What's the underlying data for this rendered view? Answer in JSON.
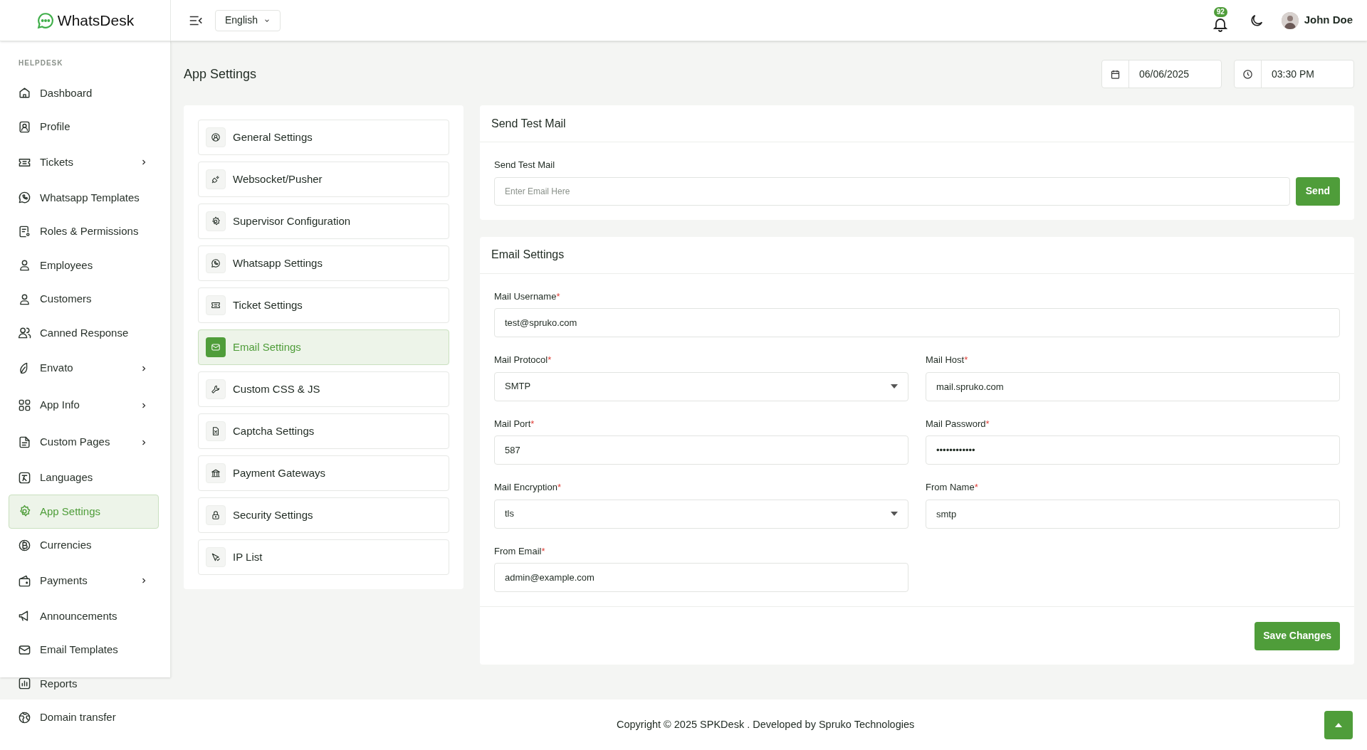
{
  "brand": {
    "name": "WhatsDesk"
  },
  "header": {
    "language": "English",
    "notifications": "92",
    "user": "John Doe"
  },
  "sidebar": {
    "section": "HELPDESK",
    "items": [
      {
        "label": "Dashboard",
        "expandable": false,
        "selected": false
      },
      {
        "label": "Profile",
        "expandable": false,
        "selected": false
      },
      {
        "label": "Tickets",
        "expandable": true,
        "selected": false
      },
      {
        "label": "Whatsapp Templates",
        "expandable": false,
        "selected": false
      },
      {
        "label": "Roles & Permissions",
        "expandable": false,
        "selected": false
      },
      {
        "label": "Employees",
        "expandable": false,
        "selected": false
      },
      {
        "label": "Customers",
        "expandable": false,
        "selected": false
      },
      {
        "label": "Canned Response",
        "expandable": false,
        "selected": false
      },
      {
        "label": "Envato",
        "expandable": true,
        "selected": false
      },
      {
        "label": "App Info",
        "expandable": true,
        "selected": false
      },
      {
        "label": "Custom Pages",
        "expandable": true,
        "selected": false
      },
      {
        "label": "Languages",
        "expandable": false,
        "selected": false
      },
      {
        "label": "App Settings",
        "expandable": false,
        "selected": true
      },
      {
        "label": "Currencies",
        "expandable": false,
        "selected": false
      },
      {
        "label": "Payments",
        "expandable": true,
        "selected": false
      },
      {
        "label": "Announcements",
        "expandable": false,
        "selected": false
      },
      {
        "label": "Email Templates",
        "expandable": false,
        "selected": false
      },
      {
        "label": "Reports",
        "expandable": false,
        "selected": false
      },
      {
        "label": "Domain transfer",
        "expandable": false,
        "selected": false
      }
    ]
  },
  "page": {
    "title": "App Settings",
    "date": "06/06/2025",
    "time": "03:30 PM"
  },
  "settings_menu": [
    {
      "label": "General Settings",
      "selected": false
    },
    {
      "label": "Websocket/Pusher",
      "selected": false
    },
    {
      "label": "Supervisor Configuration",
      "selected": false
    },
    {
      "label": "Whatsapp Settings",
      "selected": false
    },
    {
      "label": "Ticket Settings",
      "selected": false
    },
    {
      "label": "Email Settings",
      "selected": true
    },
    {
      "label": "Custom CSS & JS",
      "selected": false
    },
    {
      "label": "Captcha Settings",
      "selected": false
    },
    {
      "label": "Payment Gateways",
      "selected": false
    },
    {
      "label": "Security Settings",
      "selected": false
    },
    {
      "label": "IP List",
      "selected": false
    }
  ],
  "test_mail": {
    "title": "Send Test Mail",
    "label": "Send Test Mail",
    "placeholder": "Enter Email Here",
    "button": "Send"
  },
  "email_settings": {
    "title": "Email Settings",
    "fields": [
      {
        "label": "Mail Username",
        "marker": "*",
        "kind": "text",
        "value": "test@spruko.com"
      },
      {
        "label": "Mail Protocol",
        "marker": "*",
        "kind": "select",
        "value": "SMTP"
      },
      {
        "label": "Mail Host",
        "marker": "*",
        "kind": "text",
        "value": "mail.spruko.com"
      },
      {
        "label": "Mail Port",
        "marker": "*",
        "kind": "text",
        "value": "587"
      },
      {
        "label": "Mail Password",
        "marker": "*",
        "kind": "text",
        "value": "••••••••••••"
      },
      {
        "label": "Mail Encryption",
        "marker": "*",
        "kind": "select",
        "value": "tls"
      },
      {
        "label": "From Name",
        "marker": "*",
        "kind": "text",
        "value": "smtp"
      },
      {
        "label": "From Email",
        "marker": "*",
        "kind": "text",
        "value": "admin@example.com"
      }
    ],
    "button": "Save Changes"
  },
  "footer": {
    "text": "Copyright © 2025 SPKDesk . Developed by Spruko Technologies"
  }
}
